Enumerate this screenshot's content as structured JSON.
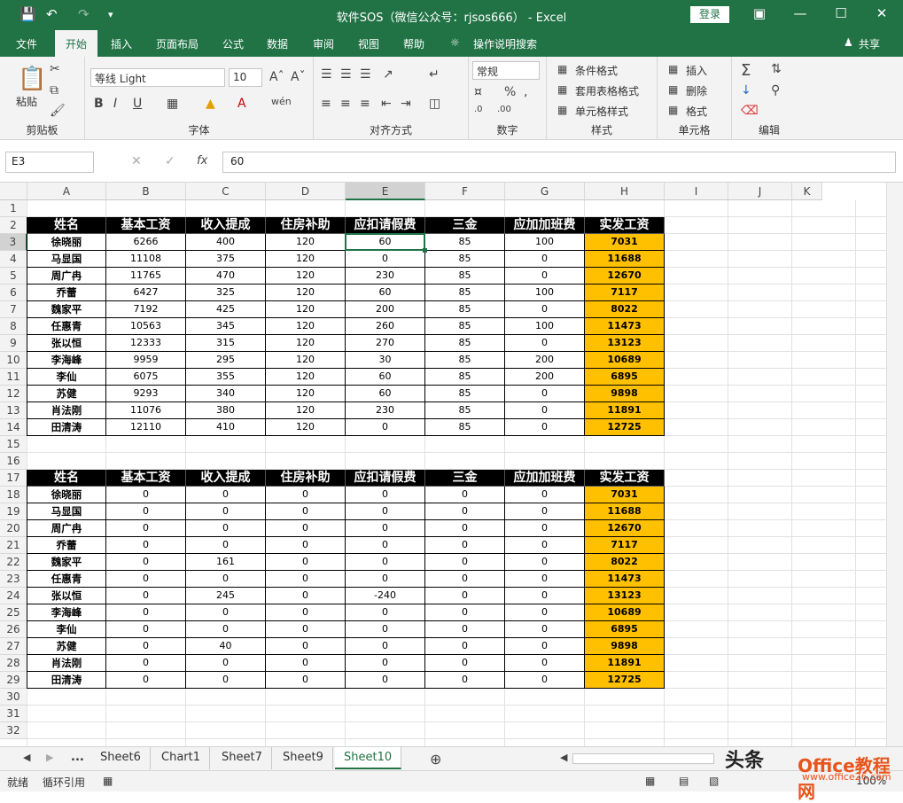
{
  "titlebar": {
    "title": "软件SOS（微信公众号：rjsos666） - Excel",
    "login": "登录"
  },
  "tabs": [
    "文件",
    "开始",
    "插入",
    "页面布局",
    "公式",
    "数据",
    "审阅",
    "视图",
    "帮助",
    "操作说明搜索"
  ],
  "share": "共享",
  "ribbon": {
    "clipboard": {
      "label": "剪贴板",
      "paste": "粘贴"
    },
    "font": {
      "label": "字体",
      "name": "等线 Light",
      "size": "10"
    },
    "align": {
      "label": "对齐方式"
    },
    "number": {
      "label": "数字",
      "format": "常规"
    },
    "styles": {
      "label": "样式",
      "cond": "条件格式",
      "table": "套用表格格式",
      "cell": "单元格样式"
    },
    "cells": {
      "label": "单元格",
      "insert": "插入",
      "delete": "删除",
      "format": "格式"
    },
    "edit": {
      "label": "编辑"
    }
  },
  "formula_bar": {
    "cell_ref": "E3",
    "value": "60",
    "fx": "fx"
  },
  "columns": [
    "A",
    "B",
    "C",
    "D",
    "E",
    "F",
    "G",
    "H",
    "I",
    "J",
    "K"
  ],
  "rows": [
    "1",
    "2",
    "3",
    "4",
    "5",
    "6",
    "7",
    "8",
    "9",
    "10",
    "11",
    "12",
    "13",
    "14",
    "15",
    "16",
    "17",
    "18",
    "19",
    "20",
    "21",
    "22",
    "23",
    "24",
    "25",
    "26",
    "27",
    "28",
    "29",
    "30",
    "31",
    "32"
  ],
  "headers": [
    "姓名",
    "基本工资",
    "收入提成",
    "住房补助",
    "应扣请假费",
    "三金",
    "应加加班费",
    "实发工资"
  ],
  "table1": [
    [
      "徐晓丽",
      "6266",
      "400",
      "120",
      "60",
      "85",
      "100",
      "7031"
    ],
    [
      "马显国",
      "11108",
      "375",
      "120",
      "0",
      "85",
      "0",
      "11688"
    ],
    [
      "周广冉",
      "11765",
      "470",
      "120",
      "230",
      "85",
      "0",
      "12670"
    ],
    [
      "乔蕾",
      "6427",
      "325",
      "120",
      "60",
      "85",
      "100",
      "7117"
    ],
    [
      "魏家平",
      "7192",
      "425",
      "120",
      "200",
      "85",
      "0",
      "8022"
    ],
    [
      "任惠青",
      "10563",
      "345",
      "120",
      "260",
      "85",
      "100",
      "11473"
    ],
    [
      "张以恒",
      "12333",
      "315",
      "120",
      "270",
      "85",
      "0",
      "13123"
    ],
    [
      "李海峰",
      "9959",
      "295",
      "120",
      "30",
      "85",
      "200",
      "10689"
    ],
    [
      "李仙",
      "6075",
      "355",
      "120",
      "60",
      "85",
      "200",
      "6895"
    ],
    [
      "苏健",
      "9293",
      "340",
      "120",
      "60",
      "85",
      "0",
      "9898"
    ],
    [
      "肖法刚",
      "11076",
      "380",
      "120",
      "230",
      "85",
      "0",
      "11891"
    ],
    [
      "田清涛",
      "12110",
      "410",
      "120",
      "0",
      "85",
      "0",
      "12725"
    ]
  ],
  "table2": [
    [
      "徐晓丽",
      "0",
      "0",
      "0",
      "0",
      "0",
      "0",
      "7031"
    ],
    [
      "马显国",
      "0",
      "0",
      "0",
      "0",
      "0",
      "0",
      "11688"
    ],
    [
      "周广冉",
      "0",
      "0",
      "0",
      "0",
      "0",
      "0",
      "12670"
    ],
    [
      "乔蕾",
      "0",
      "0",
      "0",
      "0",
      "0",
      "0",
      "7117"
    ],
    [
      "魏家平",
      "0",
      "161",
      "0",
      "0",
      "0",
      "0",
      "8022"
    ],
    [
      "任惠青",
      "0",
      "0",
      "0",
      "0",
      "0",
      "0",
      "11473"
    ],
    [
      "张以恒",
      "0",
      "245",
      "0",
      "-240",
      "0",
      "0",
      "13123"
    ],
    [
      "李海峰",
      "0",
      "0",
      "0",
      "0",
      "0",
      "0",
      "10689"
    ],
    [
      "李仙",
      "0",
      "0",
      "0",
      "0",
      "0",
      "0",
      "6895"
    ],
    [
      "苏健",
      "0",
      "40",
      "0",
      "0",
      "0",
      "0",
      "9898"
    ],
    [
      "肖法刚",
      "0",
      "0",
      "0",
      "0",
      "0",
      "0",
      "11891"
    ],
    [
      "田清涛",
      "0",
      "0",
      "0",
      "0",
      "0",
      "0",
      "12725"
    ]
  ],
  "sheets": [
    "...",
    "Sheet6",
    "Chart1",
    "Sheet7",
    "Sheet9",
    "Sheet10"
  ],
  "active_sheet": "Sheet10",
  "status": {
    "ready": "就绪",
    "circular": "循环引用",
    "zoom": "100%"
  },
  "watermark": {
    "a": "头条",
    "b": "Office教程网",
    "c": "www.office26.com"
  },
  "colors": {
    "accent": "#217346",
    "total": "#ffc000",
    "header": "#000000"
  }
}
